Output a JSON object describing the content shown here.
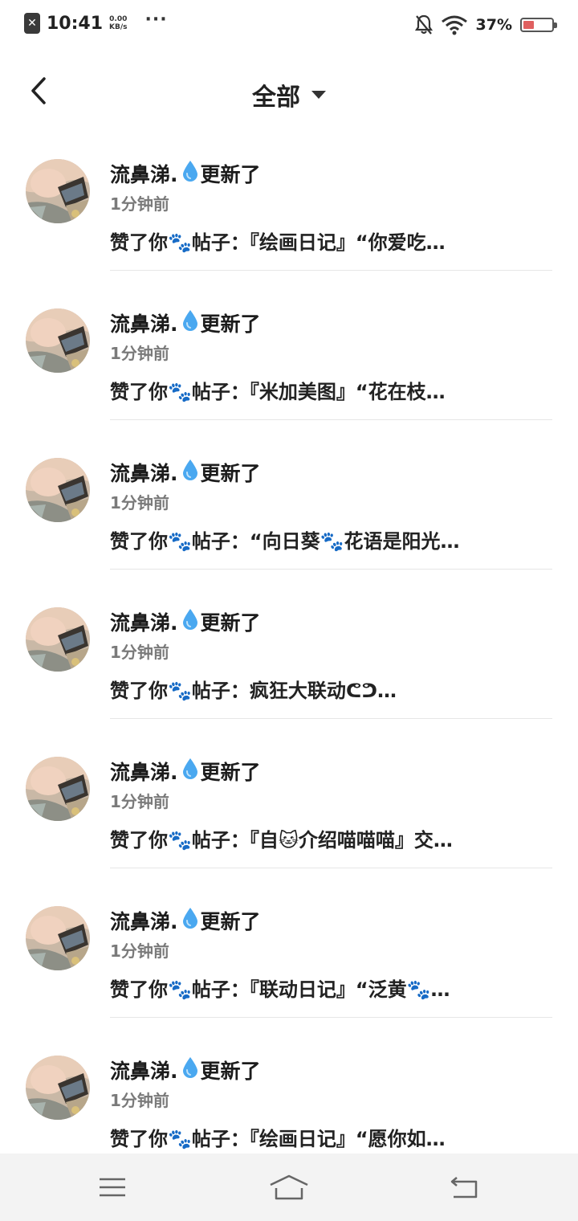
{
  "status_bar": {
    "time": "10:41",
    "speed_value": "0.00",
    "speed_unit": "KB/s",
    "dots": "···",
    "battery_percent": "37%",
    "battery_level": 0.37
  },
  "header": {
    "title": "全部"
  },
  "feed": [
    {
      "user": "流鼻涕.",
      "action": "更新了",
      "time": "1分钟前",
      "text": "赞了你🐾帖子：『绘画日记』“你爱吃…"
    },
    {
      "user": "流鼻涕.",
      "action": "更新了",
      "time": "1分钟前",
      "text": "赞了你🐾帖子：『米加美图』“花在枝…"
    },
    {
      "user": "流鼻涕.",
      "action": "更新了",
      "time": "1分钟前",
      "text": "赞了你🐾帖子：“向日葵🐾花语是阳光…"
    },
    {
      "user": "流鼻涕.",
      "action": "更新了",
      "time": "1分钟前",
      "text": "赞了你🐾帖子：疯狂大联动ᕦᕤ…"
    },
    {
      "user": "流鼻涕.",
      "action": "更新了",
      "time": "1分钟前",
      "text": "赞了你🐾帖子：『自🐱介绍喵喵喵』交…"
    },
    {
      "user": "流鼻涕.",
      "action": "更新了",
      "time": "1分钟前",
      "text": "赞了你🐾帖子：『联动日记』“泛黄🐾…"
    },
    {
      "user": "流鼻涕.",
      "action": "更新了",
      "time": "1分钟前",
      "text": "赞了你🐾帖子：『绘画日记』“愿你如…"
    }
  ],
  "icons": {
    "back": "chevron-left-icon",
    "title_caret": "caret-down-icon",
    "name_suffix": "water-drop-icon",
    "nav_menu": "menu-icon",
    "nav_home": "home-icon",
    "nav_back": "return-icon"
  },
  "colors": {
    "drop": "#4aa8f0",
    "battery_low": "#e06060",
    "navbar": "#f3f3f3"
  }
}
